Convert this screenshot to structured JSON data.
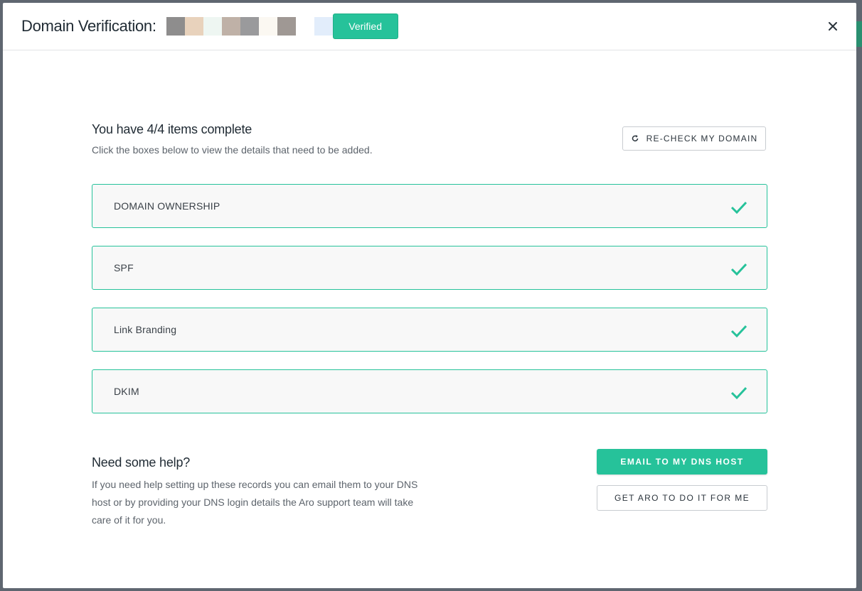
{
  "header": {
    "title": "Domain Verification:",
    "status_badge": "Verified",
    "redacted_domain_swatches": [
      "#8e8d8d",
      "#e8d2bc",
      "#eef6f2",
      "#bfb1a7",
      "#9a9a9c",
      "#fbf8f2",
      "#9f9894",
      "#ffffff",
      "#e2edfb"
    ]
  },
  "summary": {
    "heading": "You have 4/4 items complete",
    "subtext": "Click the boxes below to view the details that need to be added.",
    "recheck_label": "RE-CHECK MY DOMAIN"
  },
  "items": [
    {
      "label": "DOMAIN OWNERSHIP",
      "status": "complete"
    },
    {
      "label": "SPF",
      "status": "complete"
    },
    {
      "label": "Link Branding",
      "status": "complete"
    },
    {
      "label": "DKIM",
      "status": "complete"
    }
  ],
  "help": {
    "title": "Need some help?",
    "text": "If you need help setting up these records you can email them to your DNS host or by providing your DNS login details the Aro support team will take care of it for you.",
    "email_button": "EMAIL TO MY DNS HOST",
    "aro_button": "GET ARO TO DO IT FOR ME"
  },
  "colors": {
    "accent": "#26c29a",
    "text_dark": "#1f2a33",
    "text_muted": "#5d646c"
  }
}
